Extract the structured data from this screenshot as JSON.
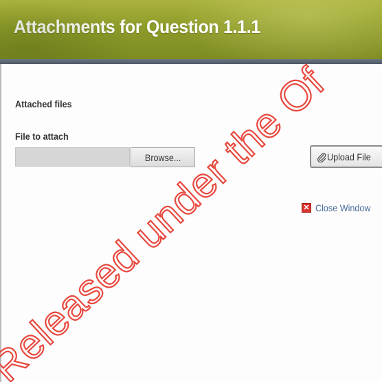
{
  "window": {
    "title": "Attachments for Question 1.1.1"
  },
  "attached_files": {
    "label": "Attached files"
  },
  "upload": {
    "file_label": "File to attach",
    "file_value": "",
    "browse_label": "Browse...",
    "upload_label": "Upload File",
    "upload_icon": "paperclip-icon"
  },
  "close": {
    "label": "Close Window",
    "icon": "close-icon"
  },
  "watermark": {
    "text": "Released under the Of",
    "color": "#e8483e"
  },
  "colors": {
    "header": "#8f9c2a",
    "header_bar": "#5a6473",
    "link": "#4a6d9c",
    "close_icon": "#d8332e"
  }
}
